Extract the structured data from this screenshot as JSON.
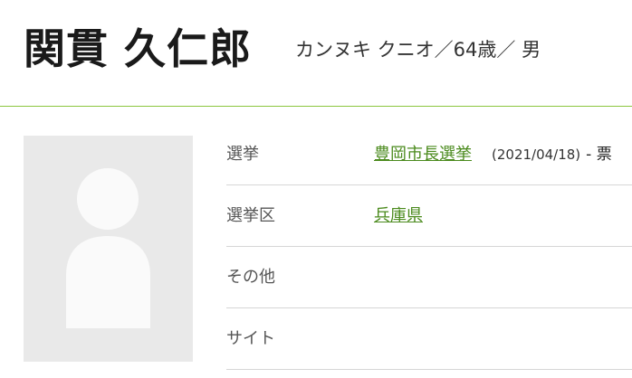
{
  "candidate": {
    "name": "関貫 久仁郎",
    "meta": "カンヌキ クニオ／64歳／ 男"
  },
  "avatar": {
    "icon": "person-placeholder-icon"
  },
  "profile": {
    "election_label": "選挙",
    "election_name": "豊岡市長選挙",
    "election_date": "(2021/04/18)",
    "election_votes": "- 票",
    "district_label": "選挙区",
    "district_name": "兵庫県",
    "other_label": "その他",
    "other_value": "",
    "site_label": "サイト",
    "site_value": ""
  },
  "colors": {
    "accent": "#8cc63f",
    "link": "#4a8a1c",
    "avatar_bg": "#e9e9e9"
  }
}
